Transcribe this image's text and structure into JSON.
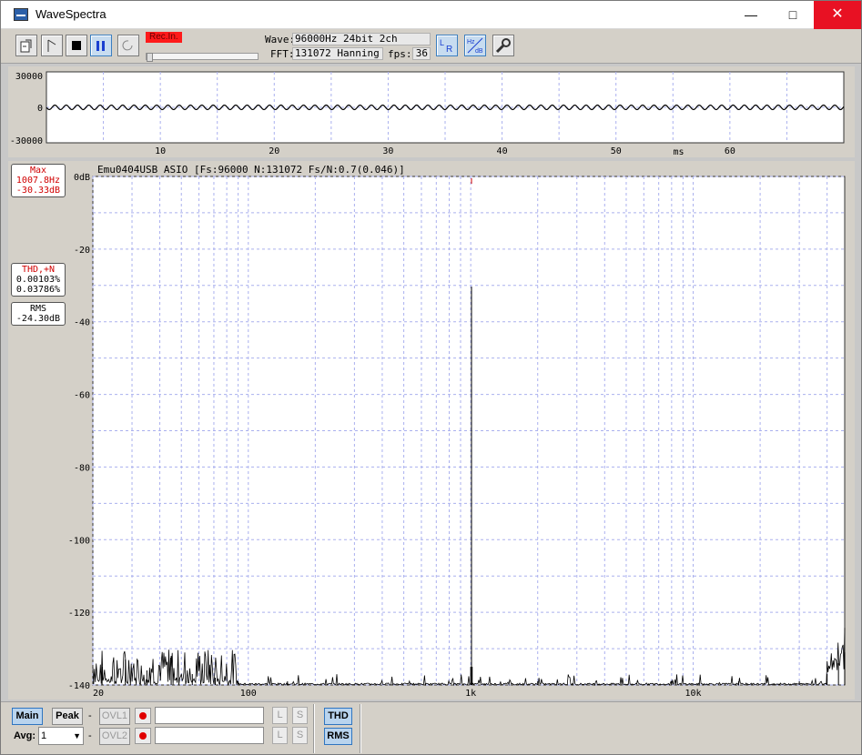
{
  "window": {
    "title": "WaveSpectra",
    "minimize": "—",
    "maximize": "□",
    "close": "✕"
  },
  "toolbar": {
    "rec_badge": "Rec.In.",
    "wave_label": "Wave:",
    "wave_value": "96000Hz 24bit 2ch",
    "fft_label": "FFT:",
    "fft_value": "131072 Hanning",
    "fps_label": "fps:",
    "fps_value": "36",
    "buttons": [
      "open-file",
      "play",
      "stop",
      "pause",
      "loop",
      "lr-channel",
      "hz-db-scale",
      "settings"
    ]
  },
  "scope": {
    "y_ticks": [
      "30000",
      "0",
      "-30000"
    ],
    "x_ticks": [
      "10",
      "20",
      "30",
      "40",
      "50",
      "60"
    ],
    "x_unit": "ms"
  },
  "spectrum": {
    "caption": "Emu0404USB ASIO  [Fs:96000 N:131072 Fs/N:0.7(0.046)]",
    "readouts": {
      "max_title": "Max",
      "max_freq": "1007.8Hz",
      "max_db": "-30.33dB",
      "thd_title": "THD,+N",
      "thd_value": "0.00103%",
      "thdn_value": "0.03786%",
      "rms_title": "RMS",
      "rms_value": "-24.30dB"
    }
  },
  "chart_data": {
    "type": "line",
    "title": "",
    "xlabel": "",
    "ylabel": "",
    "xscale": "log",
    "xlim": [
      20,
      48000
    ],
    "ylim": [
      -140,
      0
    ],
    "x_tick_labels": [
      "20",
      "100",
      "1k",
      "10k"
    ],
    "y_tick_labels": [
      "0dB",
      "-20",
      "-40",
      "-60",
      "-80",
      "-100",
      "-120",
      "-140"
    ],
    "grid": true,
    "series": [
      {
        "x": [
          20,
          22,
          25,
          28,
          31,
          35,
          40,
          45,
          50,
          56,
          63,
          71,
          80,
          90,
          100,
          150,
          200,
          300,
          500,
          700,
          900,
          1000,
          1007.8,
          1015,
          1100,
          1500,
          2000,
          3000,
          5000,
          8000,
          12000,
          16000,
          20000,
          30000,
          40000,
          45000,
          48000
        ],
        "y": [
          -140,
          -135,
          -140,
          -133,
          -140,
          -136,
          -140,
          -132,
          -140,
          -137,
          -140,
          -138,
          -140,
          -139,
          -140,
          -139,
          -140,
          -140,
          -140,
          -140,
          -140,
          -135,
          -30.33,
          -135,
          -140,
          -140,
          -139,
          -140,
          -140,
          -139,
          -140,
          -139,
          -140,
          -139,
          -137,
          -134,
          -131
        ]
      }
    ]
  },
  "bottom": {
    "main_label": "Main",
    "peak_label": "Peak",
    "dash": "-",
    "ovl1_label": "OVL1",
    "ovl2_label": "OVL2",
    "l_label": "L",
    "s_label": "S",
    "avg_label": "Avg:",
    "avg_value": "1",
    "thd_label": "THD",
    "rms_label": "RMS"
  },
  "colors": {
    "accent": "#2f75c0",
    "alert_red": "#d00000",
    "grid": "#aab0ee",
    "trace": "#000000"
  }
}
